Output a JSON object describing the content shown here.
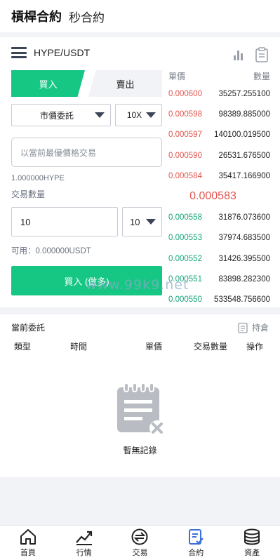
{
  "header": {
    "tab_active": "槓桿合約",
    "tab_other": "秒合約"
  },
  "pair": {
    "name": "HYPE/USDT",
    "icons": [
      "chart-bars-icon",
      "clipboard-icon"
    ]
  },
  "trade": {
    "buy_tab": "買入",
    "sell_tab": "賣出",
    "order_type": "市價委託",
    "leverage": "10X",
    "price_placeholder": "以當前最優價格交易",
    "amount_text": "1.000000HYPE",
    "qty_label": "交易數量",
    "qty_value": "10",
    "qty_unit": "10",
    "available": "可用：0.000000USDT",
    "buy_button": "買入 (做多)"
  },
  "orderbook": {
    "price_header": "單價",
    "qty_header": "數量",
    "asks": [
      {
        "price": "0.000600",
        "qty": "35257.255100"
      },
      {
        "price": "0.000598",
        "qty": "98389.885000"
      },
      {
        "price": "0.000597",
        "qty": "140100.019500"
      },
      {
        "price": "0.000590",
        "qty": "26531.676500"
      },
      {
        "price": "0.000584",
        "qty": "35417.166900"
      }
    ],
    "last_price": "0.000583",
    "bids": [
      {
        "price": "0.000558",
        "qty": "31876.073600"
      },
      {
        "price": "0.000553",
        "qty": "37974.683500"
      },
      {
        "price": "0.000552",
        "qty": "31426.395500"
      },
      {
        "price": "0.000551",
        "qty": "83898.282300"
      },
      {
        "price": "0.000550",
        "qty": "533548.756600"
      }
    ]
  },
  "orders": {
    "title": "當前委託",
    "hold": "持倉",
    "columns": [
      "類型",
      "時間",
      "單價",
      "交易數量",
      "操作"
    ],
    "empty_text": "暫無記錄"
  },
  "watermark": "www.99k9.net",
  "nav": [
    {
      "label": "首頁",
      "icon": "home-icon"
    },
    {
      "label": "行情",
      "icon": "trend-icon"
    },
    {
      "label": "交易",
      "icon": "exchange-icon"
    },
    {
      "label": "合約",
      "icon": "contract-icon"
    },
    {
      "label": "資產",
      "icon": "coins-icon"
    }
  ],
  "colors": {
    "green": "#16c784",
    "red": "#e2564f",
    "active_nav": "#3b6fd9"
  }
}
